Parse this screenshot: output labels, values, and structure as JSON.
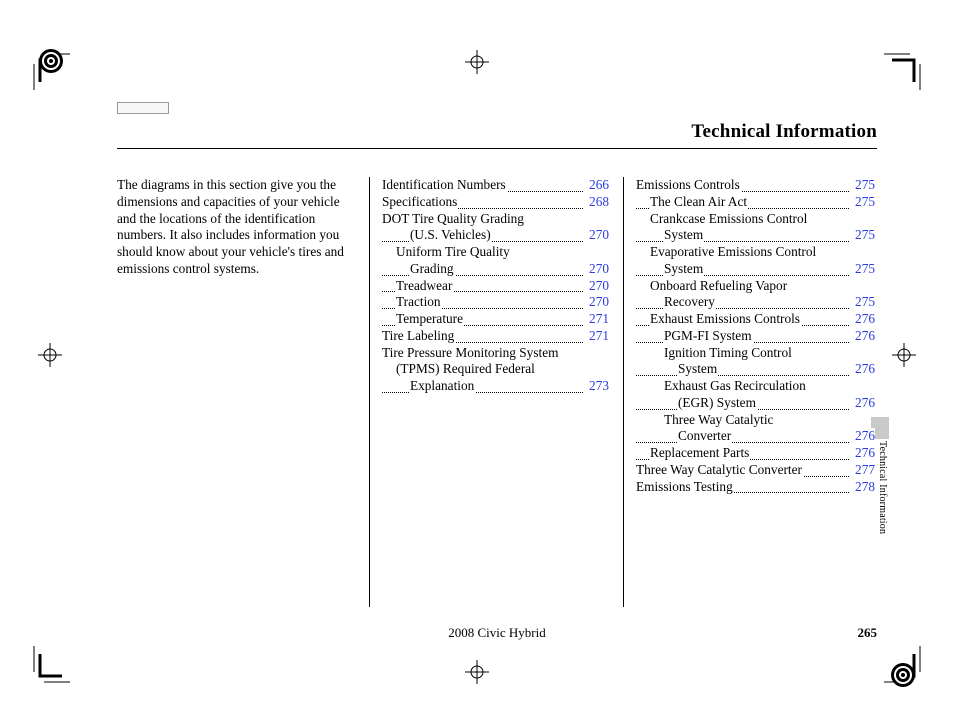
{
  "header": {
    "title": "Technical Information"
  },
  "intro": "The diagrams in this section give you the dimensions and capacities of your vehicle and the locations of the identification numbers. It also includes information you should know about your vehicle's tires and emissions control systems.",
  "toc": {
    "col1": [
      {
        "label": "Identification Numbers",
        "page": "266",
        "indent": 0,
        "cont": false
      },
      {
        "label": "Specifications",
        "page": "268",
        "indent": 0,
        "cont": false
      },
      {
        "label": "DOT Tire Quality Grading",
        "page": "",
        "indent": 0,
        "cont": true
      },
      {
        "label": "(U.S. Vehicles)",
        "page": "270",
        "indent": 2,
        "cont": false
      },
      {
        "label": "Uniform Tire Quality",
        "page": "",
        "indent": 1,
        "cont": true
      },
      {
        "label": "Grading",
        "page": "270",
        "indent": 2,
        "cont": false
      },
      {
        "label": "Treadwear",
        "page": "270",
        "indent": 1,
        "cont": false
      },
      {
        "label": "Traction",
        "page": "270",
        "indent": 1,
        "cont": false
      },
      {
        "label": "Temperature",
        "page": "271",
        "indent": 1,
        "cont": false
      },
      {
        "label": "Tire Labeling",
        "page": "271",
        "indent": 0,
        "cont": false
      },
      {
        "label": "Tire Pressure Monitoring System",
        "page": "",
        "indent": 0,
        "cont": true
      },
      {
        "label": "(TPMS)   Required Federal",
        "page": "",
        "indent": 1,
        "cont": true
      },
      {
        "label": "Explanation",
        "page": "273",
        "indent": 2,
        "cont": false
      }
    ],
    "col2": [
      {
        "label": "Emissions Controls",
        "page": "275",
        "indent": 0,
        "cont": false
      },
      {
        "label": "The Clean Air Act",
        "page": "275",
        "indent": 1,
        "cont": false
      },
      {
        "label": "Crankcase Emissions Control",
        "page": "",
        "indent": 1,
        "cont": true
      },
      {
        "label": "System",
        "page": "275",
        "indent": 2,
        "cont": false
      },
      {
        "label": "Evaporative Emissions Control",
        "page": "",
        "indent": 1,
        "cont": true
      },
      {
        "label": "System",
        "page": "275",
        "indent": 2,
        "cont": false
      },
      {
        "label": "Onboard Refueling Vapor",
        "page": "",
        "indent": 1,
        "cont": true
      },
      {
        "label": "Recovery",
        "page": "275",
        "indent": 2,
        "cont": false
      },
      {
        "label": "Exhaust Emissions Controls",
        "page": "276",
        "indent": 1,
        "cont": false
      },
      {
        "label": "PGM-FI System",
        "page": "276",
        "indent": 2,
        "cont": false
      },
      {
        "label": "Ignition Timing Control",
        "page": "",
        "indent": 2,
        "cont": true
      },
      {
        "label": "System",
        "page": "276",
        "indent": 3,
        "cont": false
      },
      {
        "label": "Exhaust Gas Recirculation",
        "page": "",
        "indent": 2,
        "cont": true
      },
      {
        "label": "(EGR) System",
        "page": "276",
        "indent": 3,
        "cont": false
      },
      {
        "label": "Three Way Catalytic",
        "page": "",
        "indent": 2,
        "cont": true
      },
      {
        "label": "Converter",
        "page": "276",
        "indent": 3,
        "cont": false
      },
      {
        "label": "Replacement Parts",
        "page": "276",
        "indent": 1,
        "cont": false
      },
      {
        "label": "Three Way Catalytic Converter",
        "page": "277",
        "indent": 0,
        "cont": false
      },
      {
        "label": "Emissions Testing",
        "page": "278",
        "indent": 0,
        "cont": false
      }
    ]
  },
  "sidetab": {
    "label": "Technical Information"
  },
  "footer": {
    "center": "2008  Civic  Hybrid",
    "page": "265"
  }
}
